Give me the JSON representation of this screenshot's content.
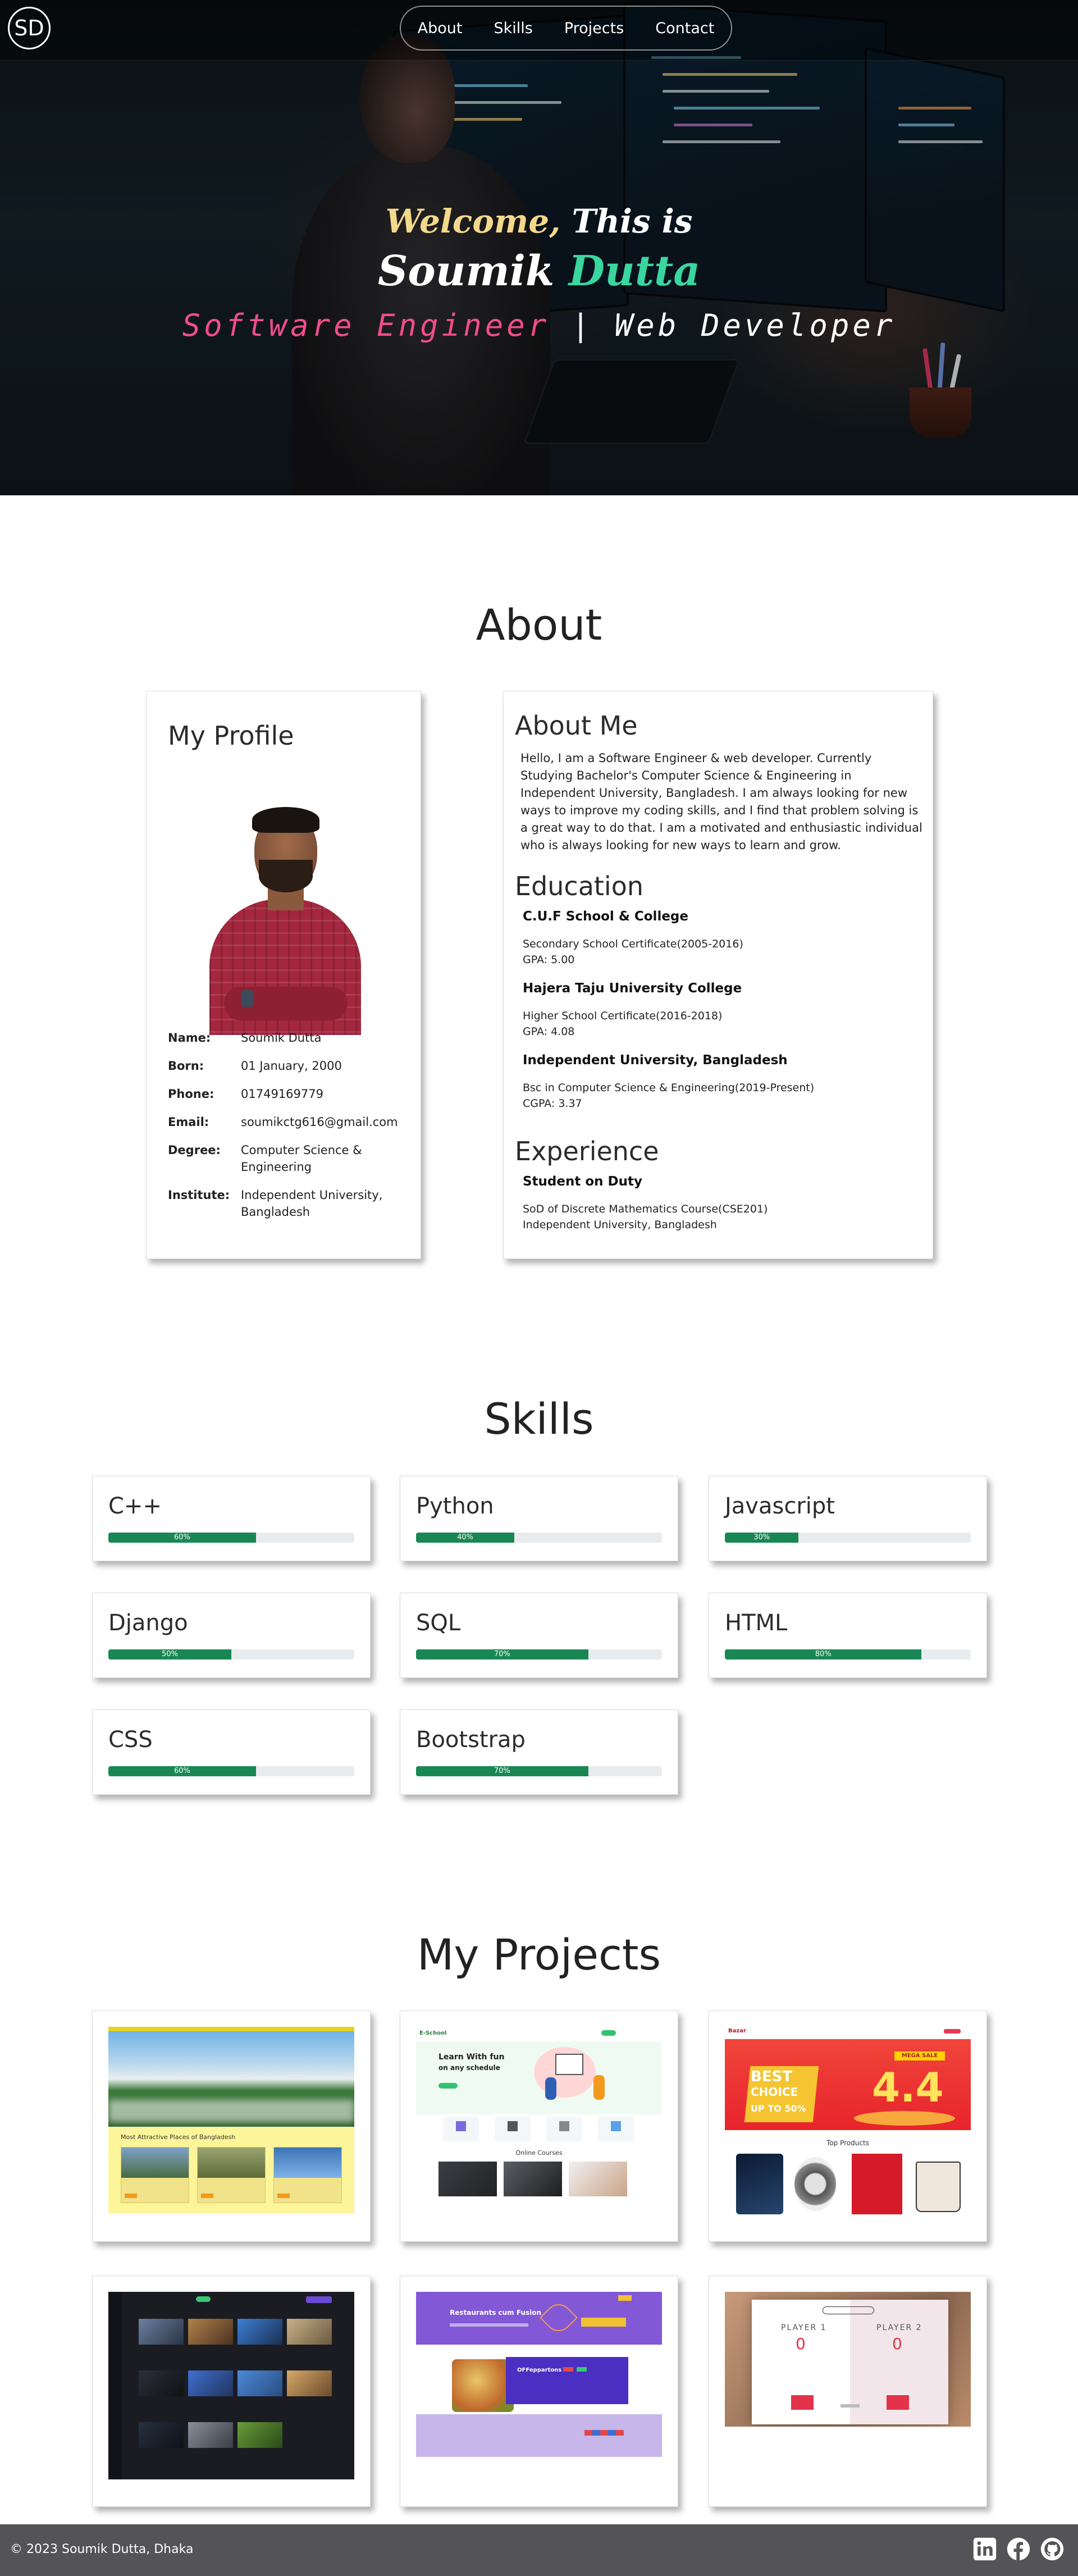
{
  "nav": {
    "logo": "SD",
    "links": [
      "About",
      "Skills",
      "Projects",
      "Contact"
    ]
  },
  "hero": {
    "welcome": "Welcome,",
    "this_is": " This is",
    "first_name": "Soumik ",
    "last_name": "Dutta",
    "role1": "Software Engineer",
    "separator": " | ",
    "role2": "Web Developer"
  },
  "about": {
    "title": "About",
    "profile": {
      "heading": "My Profile",
      "rows": [
        {
          "label": "Name:",
          "value": "Soumik Dutta"
        },
        {
          "label": "Born:",
          "value": "01 January, 2000"
        },
        {
          "label": "Phone:",
          "value": "01749169779"
        },
        {
          "label": "Email:",
          "value": "soumikctg616@gmail.com"
        },
        {
          "label": "Degree:",
          "value": "Computer Science & Engineering"
        },
        {
          "label": "Institute:",
          "value": "Independent University, Bangladesh"
        }
      ]
    },
    "about_me": {
      "heading": "About Me",
      "text": "Hello, I am a Software Engineer & web developer. Currently Studying Bachelor's Computer Science & Engineering in Independent University, Bangladesh. I am always looking for new ways to improve my coding skills, and I find that problem solving is a great way to do that. I am a motivated and enthusiastic individual who is always looking for new ways to learn and grow."
    },
    "education": {
      "heading": "Education",
      "items": [
        {
          "school": "C.U.F School & College",
          "line1": "Secondary School Certificate(2005-2016)",
          "line2": "GPA: 5.00"
        },
        {
          "school": "Hajera Taju University College",
          "line1": "Higher School Certificate(2016-2018)",
          "line2": "GPA: 4.08"
        },
        {
          "school": "Independent University, Bangladesh",
          "line1": "Bsc in Computer Science & Engineering(2019-Present)",
          "line2": "CGPA: 3.37"
        }
      ]
    },
    "experience": {
      "heading": "Experience",
      "role": "Student on Duty",
      "line1": "SoD of Discrete Mathematics Course(CSE201)",
      "line2": "Independent University, Bangladesh"
    }
  },
  "skills": {
    "title": "Skills",
    "items": [
      {
        "name": "C++",
        "percent": 60,
        "label": "60%"
      },
      {
        "name": "Python",
        "percent": 40,
        "label": "40%"
      },
      {
        "name": "Javascript",
        "percent": 30,
        "label": "30%"
      },
      {
        "name": "Django",
        "percent": 50,
        "label": "50%"
      },
      {
        "name": "SQL",
        "percent": 70,
        "label": "70%"
      },
      {
        "name": "HTML",
        "percent": 80,
        "label": "80%"
      },
      {
        "name": "CSS",
        "percent": 60,
        "label": "60%"
      },
      {
        "name": "Bootstrap",
        "percent": 70,
        "label": "70%"
      }
    ]
  },
  "projects": {
    "title": "My Projects",
    "p1": {
      "banner": "Most Attractive Places of Bangladesh"
    },
    "p2": {
      "brand": "E-School",
      "headline": "Learn With fun",
      "headline2": "on any schedule",
      "section": "Online Courses"
    },
    "p3": {
      "logo": "Bazar",
      "badge": "MEGA SALE",
      "offer1": "BEST",
      "offer2": "CHOICE",
      "offer3": "UP TO 50%",
      "big": "4.4",
      "section": "Top Products"
    },
    "p5": {
      "hero": "Restaurants cum Fusion",
      "promo": "OFFeppartons"
    },
    "p6": {
      "p1": "PLAYER 1",
      "p2": "PLAYER 2",
      "s1": "0",
      "s2": "0"
    }
  },
  "footer": {
    "text": "© 2023 Soumik Dutta, Dhaka",
    "icons": [
      "linkedin-icon",
      "facebook-icon",
      "github-icon"
    ]
  },
  "colors": {
    "accent_green": "#198754",
    "hero_name_green": "#3ad6a0",
    "hero_pink": "#f04d8a",
    "hero_gold": "#f4d98a",
    "footer_bg": "#545456"
  }
}
